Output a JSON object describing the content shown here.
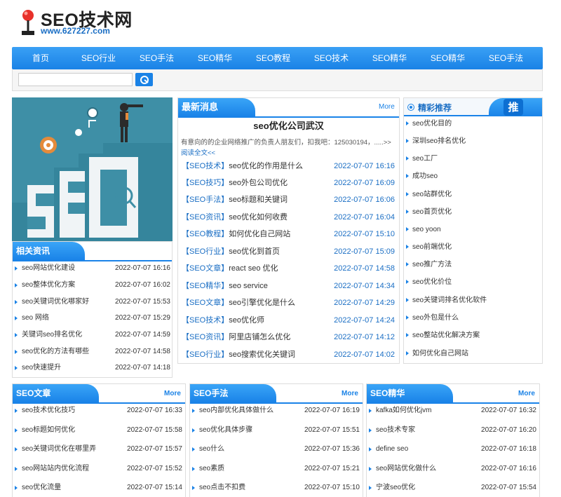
{
  "logo": {
    "title": "SEO技术网",
    "url": "www.627227.com"
  },
  "nav": {
    "items": [
      "首页",
      "SEO行业",
      "SEO手法",
      "SEO精华",
      "SEO教程",
      "SEO技术",
      "SEO精华",
      "SEO精华",
      "SEO手法"
    ]
  },
  "search": {
    "placeholder": "",
    "value": ""
  },
  "feature": {
    "label": "SEO"
  },
  "related": {
    "title": "相关资讯",
    "items": [
      {
        "title": "seo网站优化建设",
        "date": "2022-07-07 16:16"
      },
      {
        "title": "seo整体优化方案",
        "date": "2022-07-07 16:02"
      },
      {
        "title": "seo关键词优化哪家好",
        "date": "2022-07-07 15:53"
      },
      {
        "title": "seo 网络",
        "date": "2022-07-07 15:29"
      },
      {
        "title": "关键词seo排名优化",
        "date": "2022-07-07 14:59"
      },
      {
        "title": "seo优化的方法有哪些",
        "date": "2022-07-07 14:58"
      },
      {
        "title": "seo快速提升",
        "date": "2022-07-07 14:18"
      }
    ]
  },
  "news": {
    "title": "最新消息",
    "more": "More",
    "headline": "seo优化公司武汉",
    "summary": "有意向的的企业网络推广的负责人朋友们，扣我吧：125030194，.....>>",
    "read_more": "阅读全文<<",
    "items": [
      {
        "category": "【SEO技术】",
        "title": "seo优化的作用是什么",
        "date": "2022-07-07 16:16"
      },
      {
        "category": "【SEO技巧】",
        "title": "seo外包公司优化",
        "date": "2022-07-07 16:09"
      },
      {
        "category": "【SEO手法】",
        "title": "seo标题和关键词",
        "date": "2022-07-07 16:06"
      },
      {
        "category": "【SEO资讯】",
        "title": "seo优化如何收费",
        "date": "2022-07-07 16:04"
      },
      {
        "category": "【SEO教程】",
        "title": "如何优化自己网站",
        "date": "2022-07-07 15:10"
      },
      {
        "category": "【SEO行业】",
        "title": "seo优化到首页",
        "date": "2022-07-07 15:09"
      },
      {
        "category": "【SEO文章】",
        "title": "react seo 优化",
        "date": "2022-07-07 14:58"
      },
      {
        "category": "【SEO精华】",
        "title": "seo service",
        "date": "2022-07-07 14:34"
      },
      {
        "category": "【SEO文章】",
        "title": "seo引擎优化是什么",
        "date": "2022-07-07 14:29"
      },
      {
        "category": "【SEO技术】",
        "title": "seo优化师",
        "date": "2022-07-07 14:24"
      },
      {
        "category": "【SEO资讯】",
        "title": "阿里店铺怎么优化",
        "date": "2022-07-07 14:12"
      },
      {
        "category": "【SEO行业】",
        "title": "seo搜索优化关键词",
        "date": "2022-07-07 14:02"
      }
    ]
  },
  "recommend": {
    "title": "精彩推荐",
    "badge": "推",
    "items": [
      "seo优化目的",
      "深圳seo排名优化",
      "seo工厂",
      "成功seo",
      "seo站群优化",
      "seo首页优化",
      "seo yoon",
      "seo前端优化",
      "seo推广方法",
      "seo优化价位",
      "seo关键词排名优化软件",
      "seo外包是什么",
      "seo整站优化解决方案",
      "如何优化自己网站"
    ]
  },
  "columns": [
    {
      "title": "SEO文章",
      "more": "More",
      "items": [
        {
          "title": "seo技术优化技巧",
          "date": "2022-07-07 16:33"
        },
        {
          "title": "seo标题如何优化",
          "date": "2022-07-07 15:58"
        },
        {
          "title": "seo关键词优化在哪里弄",
          "date": "2022-07-07 15:57"
        },
        {
          "title": "seo网站站内优化流程",
          "date": "2022-07-07 15:52"
        },
        {
          "title": "seo优化流量",
          "date": "2022-07-07 15:14"
        }
      ]
    },
    {
      "title": "SEO手法",
      "more": "More",
      "items": [
        {
          "title": "seo内部优化具体做什么",
          "date": "2022-07-07 16:19"
        },
        {
          "title": "seo优化具体步骤",
          "date": "2022-07-07 15:51"
        },
        {
          "title": "seo什么",
          "date": "2022-07-07 15:36"
        },
        {
          "title": "seo素质",
          "date": "2022-07-07 15:21"
        },
        {
          "title": "seo点击不扣费",
          "date": "2022-07-07 15:10"
        }
      ]
    },
    {
      "title": "SEO精华",
      "more": "More",
      "items": [
        {
          "title": "kafka如何优化jvm",
          "date": "2022-07-07 16:32"
        },
        {
          "title": "seo技术专家",
          "date": "2022-07-07 16:20"
        },
        {
          "title": "define seo",
          "date": "2022-07-07 16:18"
        },
        {
          "title": "seo网站优化做什么",
          "date": "2022-07-07 16:16"
        },
        {
          "title": "宁波seo优化",
          "date": "2022-07-07 15:54"
        }
      ]
    }
  ],
  "colors": {
    "accent": "#1a82e6",
    "link": "#1a6ec4",
    "feature_bg": "#3e8fa6"
  }
}
